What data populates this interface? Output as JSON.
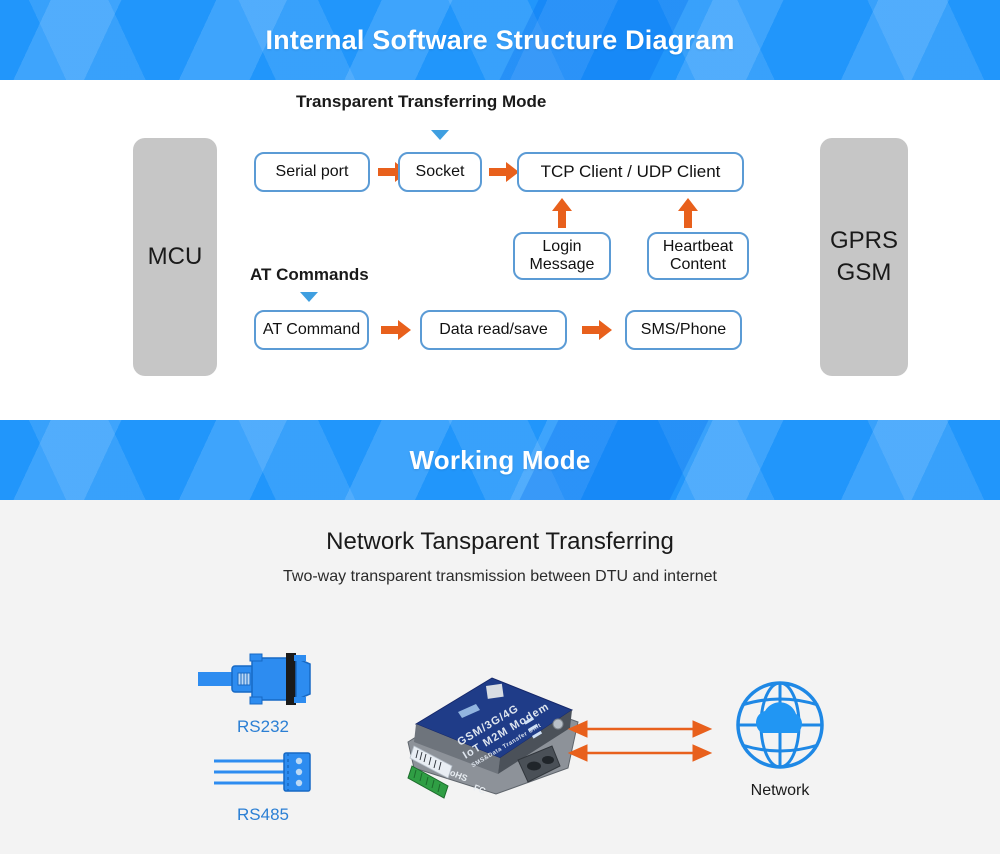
{
  "banners": {
    "top_title": "Internal Software Structure Diagram",
    "mid_title": "Working Mode",
    "accent_blue": "#2196fb"
  },
  "diagram": {
    "mcu_label": "MCU",
    "gprs_label": "GPRS\nGSM",
    "gprs_line1": "GPRS",
    "gprs_line2": "GSM",
    "transparent_mode_label": "Transparent Transferring Mode",
    "at_commands_label": "AT Commands",
    "boxes": {
      "serial_port": "Serial port",
      "socket": "Socket",
      "tcp_udp_client": "TCP Client / UDP Client",
      "login_message_line1": "Login",
      "login_message_line2": "Message",
      "heartbeat_line1": "Heartbeat",
      "heartbeat_line2": "Content",
      "at_command": "AT Command",
      "data_read_save": "Data read/save",
      "sms_phone": "SMS/Phone"
    },
    "colors": {
      "box_border": "#5b9bd5",
      "arrow_orange": "#e8601c",
      "triangle_blue": "#3f9fe0",
      "side_block_gray": "#c6c6c6"
    }
  },
  "working_mode": {
    "title": "Network Tansparent Transferring",
    "subtitle": "Two-way transparent transmission between DTU and internet",
    "ports": [
      {
        "id": "rs232",
        "label": "RS232",
        "icon": "db9-serial-connector-icon"
      },
      {
        "id": "rs485",
        "label": "RS485",
        "icon": "terminal-block-connector-icon"
      }
    ],
    "device": {
      "name": "dtu-modem-device",
      "label_line1": "GSM/3G/4G",
      "label_line2": "IoT M2M Modem",
      "label_line3": "SMS&Data Transfer Unit",
      "marks": "CE RoHS FC"
    },
    "network": {
      "label": "Network",
      "icon": "globe-cloud-icon"
    },
    "link_arrows": {
      "count": 2,
      "style": "double-headed-horizontal",
      "color": "#e8601c"
    },
    "colors": {
      "background": "#f3f3f3",
      "port_label_blue": "#2b7fd4",
      "connector_blue": "#2d8cf0"
    }
  }
}
